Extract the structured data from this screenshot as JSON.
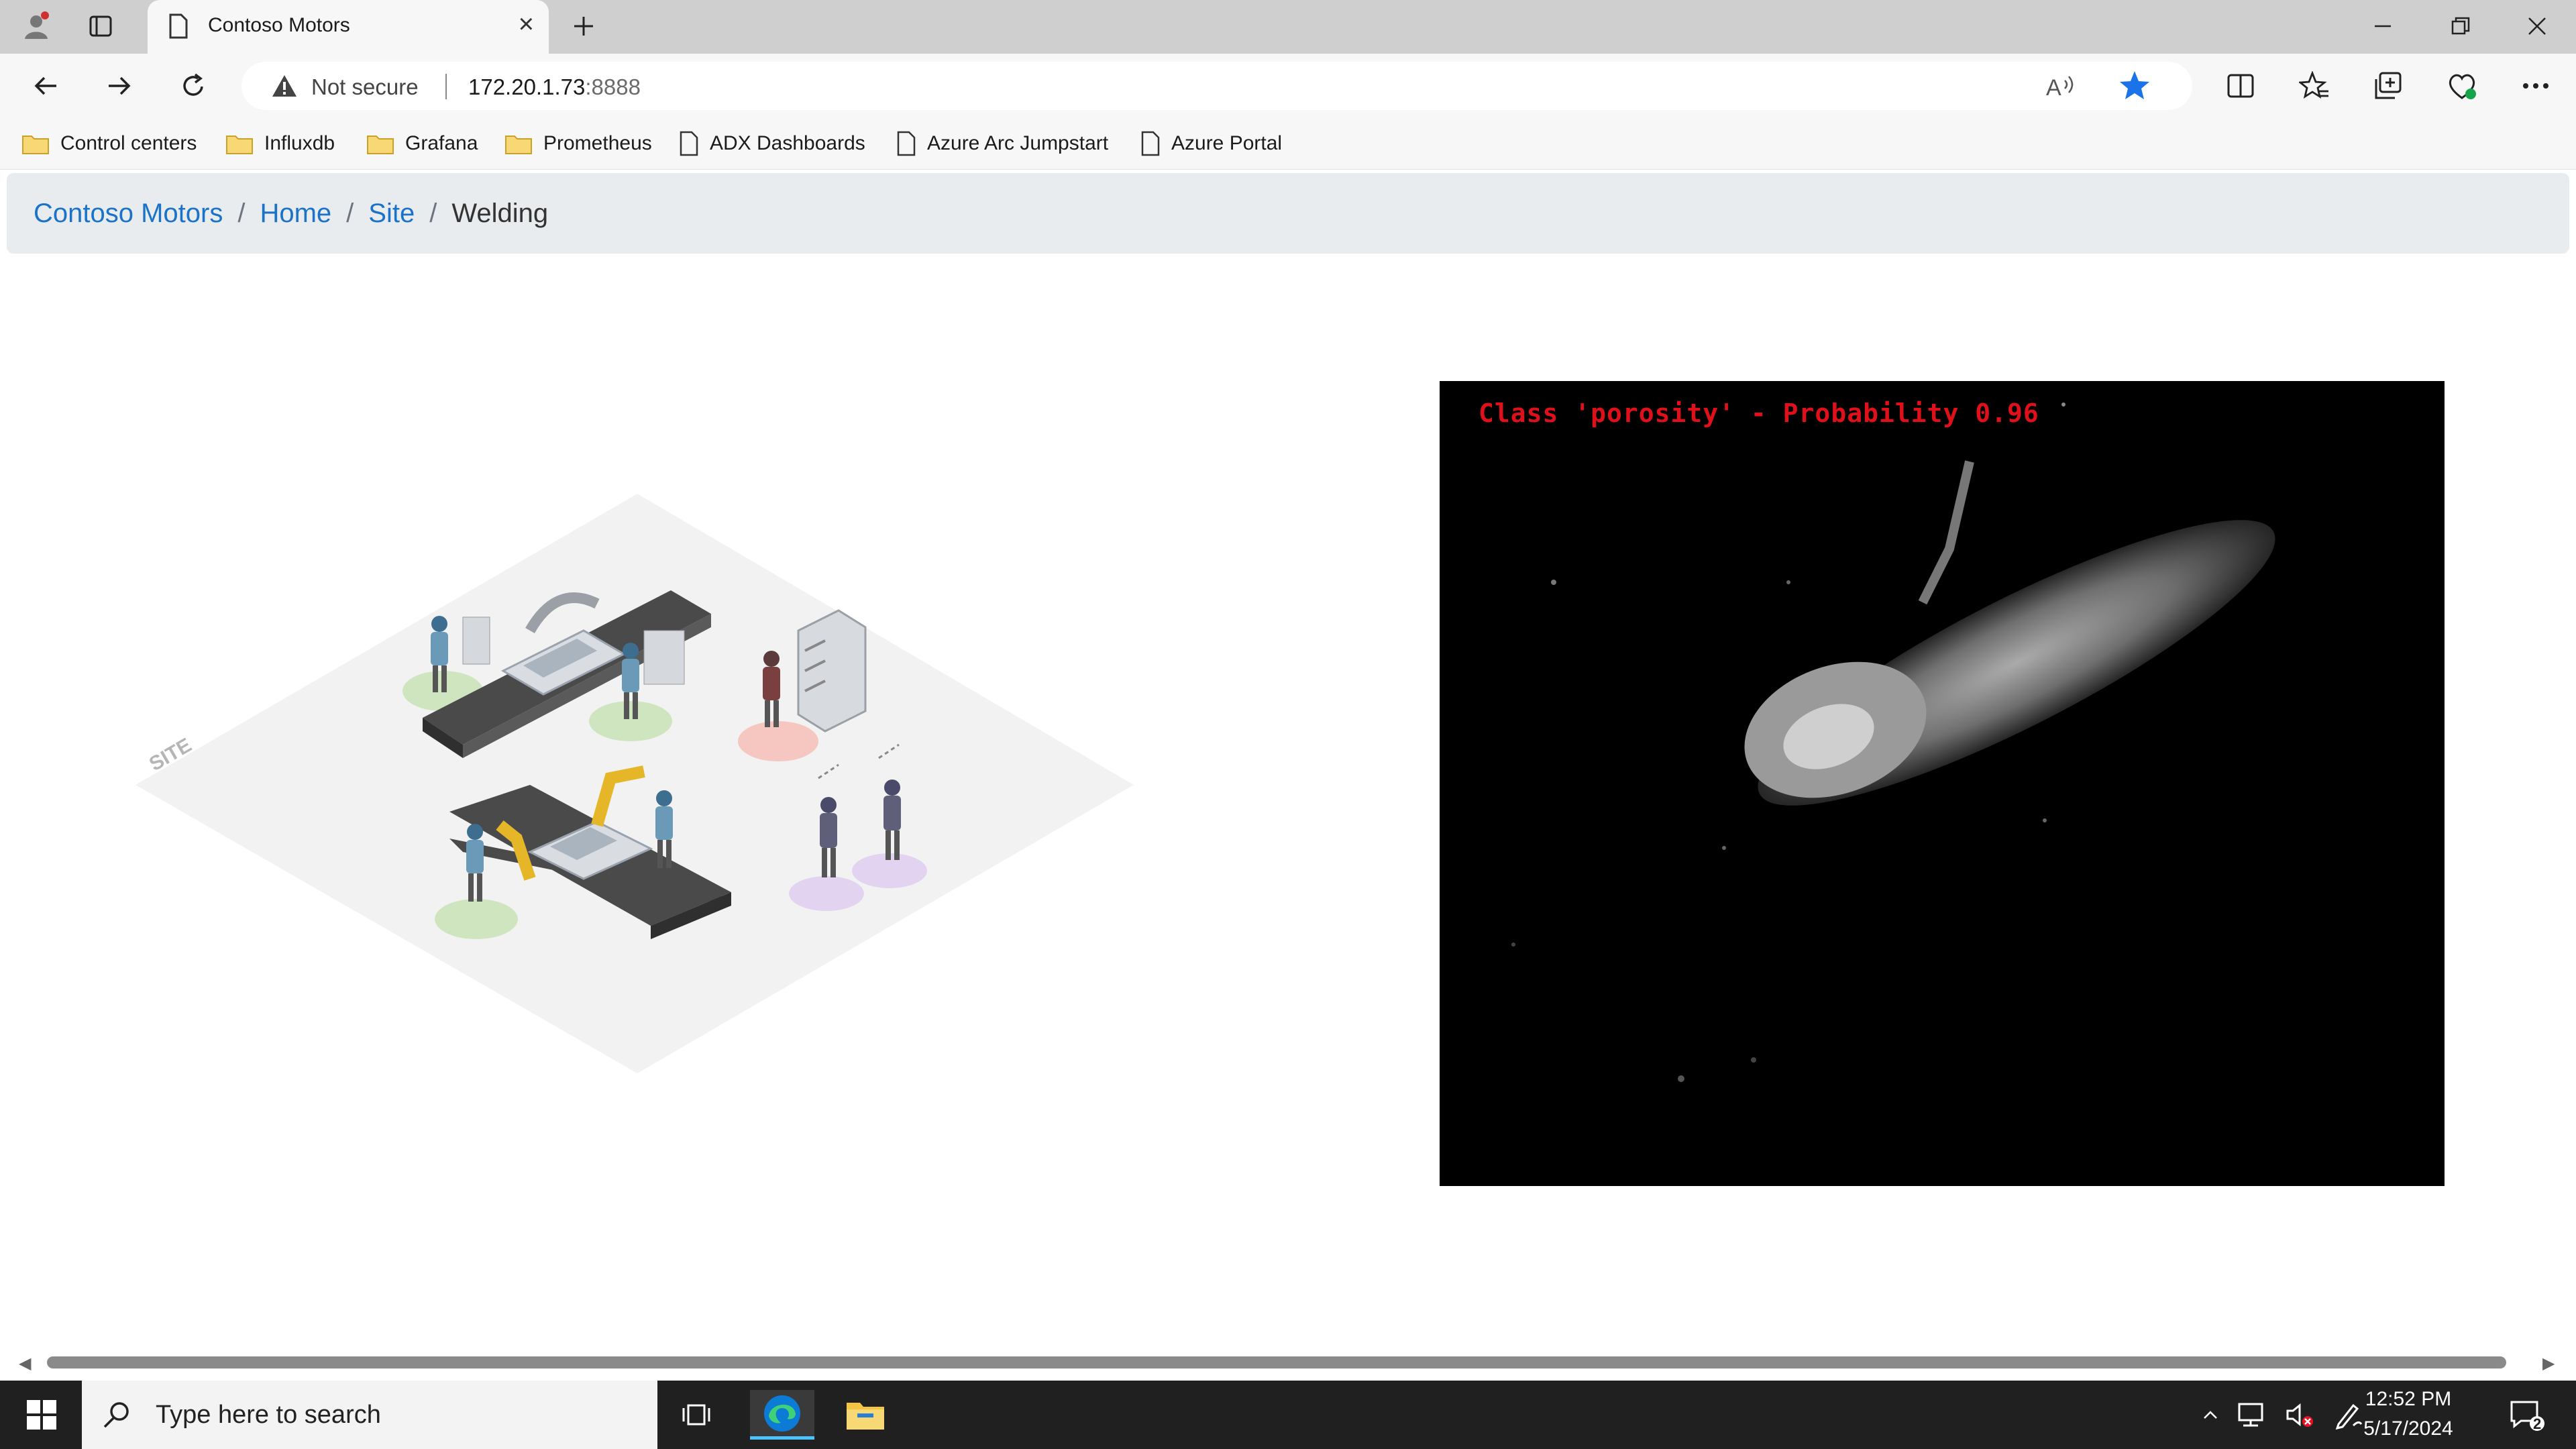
{
  "browser": {
    "tab_title": "Contoso Motors",
    "address": {
      "security_label": "Not secure",
      "host": "172.20.1.73",
      "port": ":8888"
    },
    "bookmarks": [
      {
        "label": "Control centers",
        "icon": "folder-icon"
      },
      {
        "label": "Influxdb",
        "icon": "folder-icon"
      },
      {
        "label": "Grafana",
        "icon": "folder-icon"
      },
      {
        "label": "Prometheus",
        "icon": "folder-icon"
      },
      {
        "label": "ADX Dashboards",
        "icon": "page-icon"
      },
      {
        "label": "Azure Arc Jumpstart",
        "icon": "page-icon"
      },
      {
        "label": "Azure Portal",
        "icon": "page-icon"
      }
    ]
  },
  "page": {
    "breadcrumb": [
      {
        "label": "Contoso Motors",
        "link": true
      },
      {
        "label": "Home",
        "link": true
      },
      {
        "label": "Site",
        "link": true
      },
      {
        "label": "Welding",
        "link": false
      }
    ],
    "illustration": {
      "floor_label": "SITE"
    },
    "camera": {
      "label": "Class 'porosity' - Probability 0.96"
    }
  },
  "taskbar": {
    "search_placeholder": "Type here to search",
    "time": "12:52 PM",
    "date": "5/17/2024",
    "notification_count": "2"
  },
  "colors": {
    "link": "#1a73c8",
    "detection_label": "#e0101a",
    "favorite_star": "#1a73e8"
  }
}
